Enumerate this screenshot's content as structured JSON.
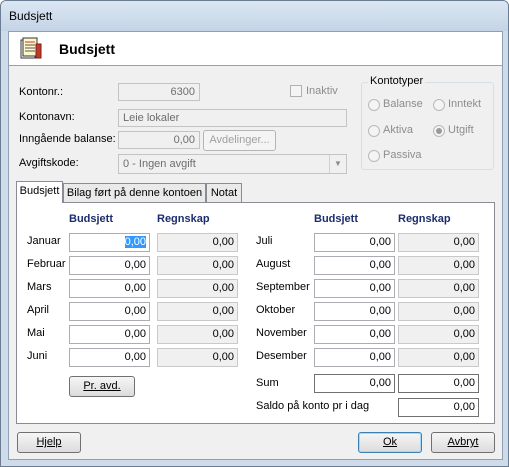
{
  "window": {
    "title": "Budsjett"
  },
  "header": {
    "title": "Budsjett"
  },
  "form": {
    "kontonr_label": "Kontonr.:",
    "kontonr_value": "6300",
    "inaktiv_label": "Inaktiv",
    "kontonavn_label": "Kontonavn:",
    "kontonavn_value": "Leie lokaler",
    "inngaende_label": "Inngående balanse:",
    "inngaende_value": "0,00",
    "avdelinger_button": "Avdelinger...",
    "avgiftskode_label": "Avgiftskode:",
    "avgiftskode_value": "0 - Ingen avgift"
  },
  "kontotyper": {
    "title": "Kontotyper",
    "options": [
      "Balanse",
      "Inntekt",
      "Aktiva",
      "Utgift",
      "Passiva"
    ],
    "selected": "Utgift"
  },
  "tabs": [
    "Budsjett",
    "Bilag ført på denne kontoen",
    "Notat"
  ],
  "budget": {
    "col_budsjett": "Budsjett",
    "col_regnskap": "Regnskap",
    "left": [
      {
        "month": "Januar",
        "budsjett": "0,00",
        "regnskap": "0,00"
      },
      {
        "month": "Februar",
        "budsjett": "0,00",
        "regnskap": "0,00"
      },
      {
        "month": "Mars",
        "budsjett": "0,00",
        "regnskap": "0,00"
      },
      {
        "month": "April",
        "budsjett": "0,00",
        "regnskap": "0,00"
      },
      {
        "month": "Mai",
        "budsjett": "0,00",
        "regnskap": "0,00"
      },
      {
        "month": "Juni",
        "budsjett": "0,00",
        "regnskap": "0,00"
      }
    ],
    "right": [
      {
        "month": "Juli",
        "budsjett": "0,00",
        "regnskap": "0,00"
      },
      {
        "month": "August",
        "budsjett": "0,00",
        "regnskap": "0,00"
      },
      {
        "month": "September",
        "budsjett": "0,00",
        "regnskap": "0,00"
      },
      {
        "month": "Oktober",
        "budsjett": "0,00",
        "regnskap": "0,00"
      },
      {
        "month": "November",
        "budsjett": "0,00",
        "regnskap": "0,00"
      },
      {
        "month": "Desember",
        "budsjett": "0,00",
        "regnskap": "0,00"
      }
    ],
    "sum_label": "Sum",
    "sum_budsjett": "0,00",
    "sum_regnskap": "0,00",
    "saldo_label": "Saldo på konto pr i dag",
    "saldo_value": "0,00",
    "pr_avd_button": "Pr. avd."
  },
  "footer": {
    "help": "Hjelp",
    "ok": "Ok",
    "cancel": "Avbryt"
  }
}
